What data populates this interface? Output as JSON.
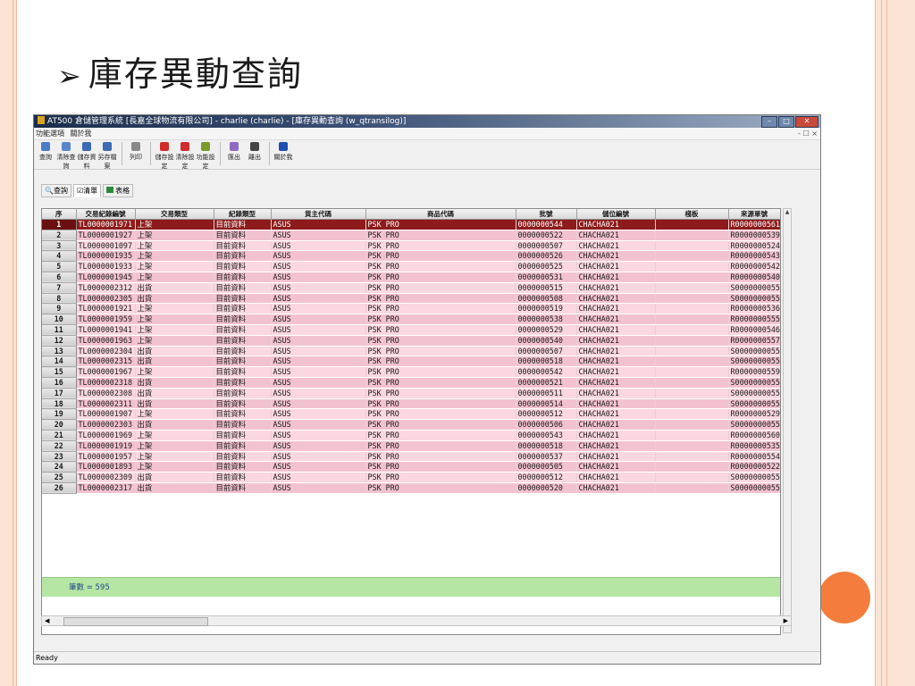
{
  "slide": {
    "title": "庫存異動查詢"
  },
  "window": {
    "title": "AT500 倉儲管理系統 [長嘉全球物流有限公司] - charlie (charlie) - [庫存異動查詢 (w_qtransilog)]",
    "menu": [
      "功能選項",
      "關於我"
    ],
    "mdi_controls": "- ☐ ×"
  },
  "toolbar": [
    {
      "label": "查詢",
      "icon": "search-icon",
      "color": "#4a7bc8"
    },
    {
      "label": "清除查詢",
      "icon": "clear-query-icon",
      "color": "#5a86c9"
    },
    {
      "label": "儲存資料",
      "icon": "save-icon",
      "color": "#3d6bb3"
    },
    {
      "label": "另存檔案",
      "icon": "save-as-icon",
      "color": "#3d6bb3"
    },
    {
      "label": "列印",
      "icon": "print-icon",
      "color": "#888888"
    },
    {
      "label": "儲存設定",
      "icon": "save-settings-icon",
      "color": "#d12b2b"
    },
    {
      "label": "清除設定",
      "icon": "clear-settings-icon",
      "color": "#d12b2b"
    },
    {
      "label": "功能設定",
      "icon": "function-settings-icon",
      "color": "#7a9a2b"
    },
    {
      "label": "匯出",
      "icon": "export-icon",
      "color": "#8e6bc0"
    },
    {
      "label": "離出",
      "icon": "exit-icon",
      "color": "#444444"
    },
    {
      "label": "關於我",
      "icon": "about-icon",
      "color": "#1e4fb0"
    }
  ],
  "tabs": [
    {
      "label": "查詢",
      "icon": "search-icon"
    },
    {
      "label": "清單",
      "icon": "list-icon"
    },
    {
      "label": "表格",
      "icon": "table-icon"
    }
  ],
  "grid": {
    "columns": [
      "序",
      "交易紀錄編號",
      "交易類型",
      "紀錄類型",
      "貨主代碼",
      "商品代碼",
      "批號",
      "儲位編號",
      "棧板",
      "來源單號"
    ],
    "selected_row": 0,
    "rows": [
      [
        "1",
        "TL0000001971",
        "上架",
        "目前資料",
        "ASUS",
        "PSK PRO",
        "0000000544",
        "CHACHA021",
        "",
        "R0000000561"
      ],
      [
        "2",
        "TL0000001927",
        "上架",
        "目前資料",
        "ASUS",
        "PSK PRO",
        "0000000522",
        "CHACHA021",
        "",
        "R0000000539"
      ],
      [
        "3",
        "TL0000001097",
        "上架",
        "目前資料",
        "ASUS",
        "PSK PRO",
        "0000000507",
        "CHACHA021",
        "",
        "R0000000524"
      ],
      [
        "4",
        "TL0000001935",
        "上架",
        "目前資料",
        "ASUS",
        "PSK PRO",
        "0000000526",
        "CHACHA021",
        "",
        "R0000000543"
      ],
      [
        "5",
        "TL0000001933",
        "上架",
        "目前資料",
        "ASUS",
        "PSK PRO",
        "0000000525",
        "CHACHA021",
        "",
        "R0000000542"
      ],
      [
        "6",
        "TL0000001945",
        "上架",
        "目前資料",
        "ASUS",
        "PSK PRO",
        "0000000531",
        "CHACHA021",
        "",
        "R0000000540"
      ],
      [
        "7",
        "TL0000002312",
        "出貨",
        "目前資料",
        "ASUS",
        "PSK PRO",
        "0000000515",
        "CHACHA021",
        "",
        "S0000000055"
      ],
      [
        "8",
        "TL0000002305",
        "出貨",
        "目前資料",
        "ASUS",
        "PSK PRO",
        "0000000508",
        "CHACHA021",
        "",
        "S0000000055"
      ],
      [
        "9",
        "TL0000001921",
        "上架",
        "目前資料",
        "ASUS",
        "PSK PRO",
        "0000000519",
        "CHACHA021",
        "",
        "R0000000536"
      ],
      [
        "10",
        "TL0000001959",
        "上架",
        "目前資料",
        "ASUS",
        "PSK PRO",
        "0000000538",
        "CHACHA021",
        "",
        "R0000000555"
      ],
      [
        "11",
        "TL0000001941",
        "上架",
        "目前資料",
        "ASUS",
        "PSK PRO",
        "0000000529",
        "CHACHA021",
        "",
        "R0000000546"
      ],
      [
        "12",
        "TL0000001963",
        "上架",
        "目前資料",
        "ASUS",
        "PSK PRO",
        "0000000540",
        "CHACHA021",
        "",
        "R0000000557"
      ],
      [
        "13",
        "TL0000002304",
        "出貨",
        "目前資料",
        "ASUS",
        "PSK PRO",
        "0000000507",
        "CHACHA021",
        "",
        "S0000000055"
      ],
      [
        "14",
        "TL0000002315",
        "出貨",
        "目前資料",
        "ASUS",
        "PSK PRO",
        "0000000518",
        "CHACHA021",
        "",
        "S0000000055"
      ],
      [
        "15",
        "TL0000001967",
        "上架",
        "目前資料",
        "ASUS",
        "PSK PRO",
        "0000000542",
        "CHACHA021",
        "",
        "R0000000559"
      ],
      [
        "16",
        "TL0000002318",
        "出貨",
        "目前資料",
        "ASUS",
        "PSK PRO",
        "0000000521",
        "CHACHA021",
        "",
        "S0000000055"
      ],
      [
        "17",
        "TL0000002308",
        "出貨",
        "目前資料",
        "ASUS",
        "PSK PRO",
        "0000000511",
        "CHACHA021",
        "",
        "S0000000055"
      ],
      [
        "18",
        "TL0000002311",
        "出貨",
        "目前資料",
        "ASUS",
        "PSK PRO",
        "0000000514",
        "CHACHA021",
        "",
        "S0000000055"
      ],
      [
        "19",
        "TL0000001907",
        "上架",
        "目前資料",
        "ASUS",
        "PSK PRO",
        "0000000512",
        "CHACHA021",
        "",
        "R0000000529"
      ],
      [
        "20",
        "TL0000002303",
        "出貨",
        "目前資料",
        "ASUS",
        "PSK PRO",
        "0000000506",
        "CHACHA021",
        "",
        "S0000000055"
      ],
      [
        "21",
        "TL0000001969",
        "上架",
        "目前資料",
        "ASUS",
        "PSK PRO",
        "0000000543",
        "CHACHA021",
        "",
        "R0000000560"
      ],
      [
        "22",
        "TL0000001919",
        "上架",
        "目前資料",
        "ASUS",
        "PSK PRO",
        "0000000518",
        "CHACHA021",
        "",
        "R0000000535"
      ],
      [
        "23",
        "TL0000001957",
        "上架",
        "目前資料",
        "ASUS",
        "PSK PRO",
        "0000000537",
        "CHACHA021",
        "",
        "R0000000554"
      ],
      [
        "24",
        "TL0000001893",
        "上架",
        "目前資料",
        "ASUS",
        "PSK PRO",
        "0000000505",
        "CHACHA021",
        "",
        "R0000000522"
      ],
      [
        "25",
        "TL0000002309",
        "出貨",
        "目前資料",
        "ASUS",
        "PSK PRO",
        "0000000512",
        "CHACHA021",
        "",
        "S0000000055"
      ],
      [
        "26",
        "TL0000002317",
        "出貨",
        "目前資料",
        "ASUS",
        "PSK PRO",
        "0000000520",
        "CHACHA021",
        "",
        "S0000000055"
      ]
    ],
    "total": "筆數 = 595"
  },
  "status": "Ready",
  "colors": {
    "selected_row": "#8d1b1b",
    "row_light": "#fad7e1",
    "row_dark": "#f3c2d1",
    "total_bar": "#b5e6a4",
    "accent_dot": "#f47c3c"
  }
}
